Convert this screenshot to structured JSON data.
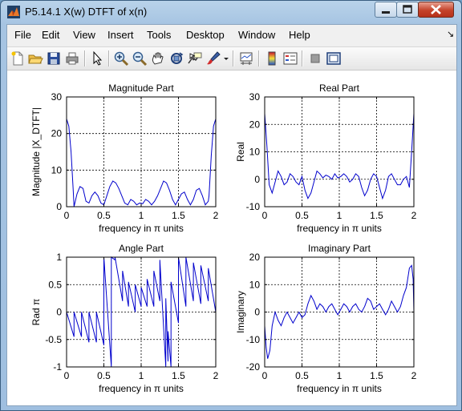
{
  "window": {
    "title": "P5.14.1 X(w) DTFT of x(n)"
  },
  "menu": [
    "File",
    "Edit",
    "View",
    "Insert",
    "Tools",
    "Desktop",
    "Window",
    "Help"
  ],
  "toolbar_icons": [
    "new-file-icon",
    "open-folder-icon",
    "save-icon",
    "print-icon",
    "pointer-icon",
    "zoom-in-icon",
    "zoom-out-icon",
    "pan-icon",
    "rotate-3d-icon",
    "data-cursor-icon",
    "brush-icon",
    "brush-dropdown-icon",
    "link-plot-icon",
    "colorbar-icon",
    "legend-icon",
    "hide-plot-tools-icon",
    "show-plot-tools-icon"
  ],
  "chart_data": [
    {
      "type": "line",
      "title": "Magnitude Part",
      "xlabel": "frequency in π units",
      "ylabel": "Magnitude  |X_DTFT|",
      "xlim": [
        0,
        2
      ],
      "ylim": [
        0,
        30
      ],
      "xticks": [
        "0",
        "0.5",
        "1",
        "1.5",
        "2"
      ],
      "yticks": [
        "0",
        "10",
        "20",
        "30"
      ],
      "grid": true,
      "color": "#0000cc",
      "x": [
        0,
        0.03,
        0.06,
        0.09,
        0.1,
        0.14,
        0.18,
        0.22,
        0.26,
        0.3,
        0.34,
        0.38,
        0.42,
        0.46,
        0.5,
        0.54,
        0.58,
        0.62,
        0.66,
        0.7,
        0.74,
        0.78,
        0.82,
        0.86,
        0.9,
        0.94,
        0.98,
        1.02,
        1.06,
        1.1,
        1.14,
        1.18,
        1.22,
        1.26,
        1.3,
        1.34,
        1.38,
        1.42,
        1.46,
        1.5,
        1.54,
        1.58,
        1.62,
        1.66,
        1.7,
        1.74,
        1.78,
        1.82,
        1.86,
        1.9,
        1.91,
        1.94,
        1.97,
        2
      ],
      "y": [
        24,
        22,
        15,
        4,
        0,
        3.5,
        5.5,
        5,
        1.5,
        1,
        3,
        4,
        3,
        1,
        0.5,
        3,
        5.5,
        7,
        6.5,
        5,
        3,
        1,
        0.5,
        2,
        1.5,
        0.5,
        1,
        0.8,
        2,
        1.5,
        0.5,
        1.5,
        3,
        5,
        7,
        6.5,
        4.5,
        2,
        0.5,
        2,
        3.5,
        4,
        2,
        0.5,
        2,
        4.5,
        5,
        3,
        0.5,
        1.5,
        3,
        14,
        22,
        24
      ]
    },
    {
      "type": "line",
      "title": "Real Part",
      "xlabel": "frequency in π units",
      "ylabel": "Real",
      "xlim": [
        0,
        2
      ],
      "ylim": [
        -10,
        30
      ],
      "xticks": [
        "0",
        "0.5",
        "1",
        "1.5",
        "2"
      ],
      "yticks": [
        "-10",
        "0",
        "10",
        "20",
        "30"
      ],
      "grid": true,
      "color": "#0000cc",
      "x": [
        0,
        0.03,
        0.06,
        0.1,
        0.14,
        0.18,
        0.22,
        0.26,
        0.3,
        0.34,
        0.38,
        0.42,
        0.46,
        0.5,
        0.54,
        0.58,
        0.62,
        0.66,
        0.7,
        0.74,
        0.78,
        0.82,
        0.86,
        0.9,
        0.94,
        0.98,
        1.02,
        1.06,
        1.1,
        1.14,
        1.18,
        1.22,
        1.26,
        1.3,
        1.34,
        1.38,
        1.42,
        1.46,
        1.5,
        1.54,
        1.58,
        1.62,
        1.66,
        1.7,
        1.74,
        1.78,
        1.82,
        1.86,
        1.9,
        1.94,
        1.97,
        2
      ],
      "y": [
        24,
        12,
        -2,
        -5,
        -1,
        3,
        1,
        -2,
        -1,
        2,
        1,
        -1,
        -2,
        1,
        -4,
        -7,
        -5,
        -1,
        3,
        2,
        0.5,
        1.5,
        1,
        0,
        2,
        0.5,
        1,
        2,
        1,
        -1,
        0,
        2,
        1,
        -3,
        -6,
        -4,
        0,
        2,
        1,
        -3,
        -7,
        -4,
        1,
        2,
        0,
        -2,
        -2,
        0,
        1,
        -3,
        10,
        24
      ]
    },
    {
      "type": "line",
      "title": "Angle Part",
      "xlabel": "frequency in π units",
      "ylabel": "Rad π",
      "xlim": [
        0,
        2
      ],
      "ylim": [
        -1,
        1
      ],
      "xticks": [
        "0",
        "0.5",
        "1",
        "1.5",
        "2"
      ],
      "yticks": [
        "-1",
        "-0.5",
        "0",
        "0.5",
        "1"
      ],
      "grid": true,
      "color": "#0000cc",
      "x": [
        0,
        0.1,
        0.1,
        0.2,
        0.2,
        0.3,
        0.3,
        0.4,
        0.4,
        0.5,
        0.5,
        0.6,
        0.6,
        0.65,
        0.65,
        0.75,
        0.75,
        0.83,
        0.83,
        0.92,
        0.92,
        1.0,
        1.0,
        1.08,
        1.08,
        1.17,
        1.17,
        1.25,
        1.25,
        1.33,
        1.33,
        1.36,
        1.36,
        1.4,
        1.4,
        1.5,
        1.5,
        1.6,
        1.6,
        1.7,
        1.7,
        1.8,
        1.8,
        1.9,
        1.9,
        2.0
      ],
      "y": [
        0,
        -0.45,
        0,
        -0.45,
        0,
        -0.55,
        0,
        -0.55,
        0,
        -0.6,
        1,
        -1,
        1,
        0.95,
        1,
        0.2,
        0.75,
        0.1,
        0.55,
        0,
        0.5,
        0.1,
        0.45,
        0.1,
        0.6,
        0.1,
        0.75,
        0.2,
        0.95,
        -1,
        0.25,
        -0.9,
        -0.35,
        -1,
        0.55,
        -0.2,
        1,
        0.1,
        1,
        0.2,
        0.9,
        0.15,
        0.85,
        0.2,
        0.8,
        0
      ]
    },
    {
      "type": "line",
      "title": "Imaginary Part",
      "xlabel": "frequency in π units",
      "ylabel": "Imaginary",
      "xlim": [
        0,
        2
      ],
      "ylim": [
        -20,
        20
      ],
      "xticks": [
        "0",
        "0.5",
        "1",
        "1.5",
        "2"
      ],
      "yticks": [
        "-20",
        "-10",
        "0",
        "10",
        "20"
      ],
      "grid": true,
      "color": "#0000cc",
      "x": [
        0,
        0.02,
        0.04,
        0.07,
        0.1,
        0.14,
        0.18,
        0.22,
        0.26,
        0.3,
        0.34,
        0.38,
        0.42,
        0.46,
        0.5,
        0.54,
        0.58,
        0.62,
        0.66,
        0.7,
        0.74,
        0.78,
        0.82,
        0.86,
        0.9,
        0.94,
        0.98,
        1.02,
        1.06,
        1.1,
        1.14,
        1.18,
        1.22,
        1.26,
        1.3,
        1.34,
        1.38,
        1.42,
        1.46,
        1.5,
        1.54,
        1.58,
        1.62,
        1.66,
        1.7,
        1.74,
        1.78,
        1.82,
        1.86,
        1.9,
        1.94,
        1.97,
        1.99,
        2
      ],
      "y": [
        -5,
        -13,
        -17,
        -14,
        -5,
        0,
        -3,
        -5,
        -2,
        0,
        -2,
        -4,
        -2,
        0,
        -2,
        -1,
        3,
        6,
        4,
        1,
        3,
        2,
        0,
        2,
        3,
        1,
        -1,
        1,
        3,
        2,
        0,
        2,
        3,
        1,
        0,
        2,
        5,
        4,
        1,
        2,
        3,
        1,
        -1,
        1,
        4,
        2,
        0,
        2,
        6,
        9,
        16,
        17,
        12,
        0
      ]
    }
  ]
}
